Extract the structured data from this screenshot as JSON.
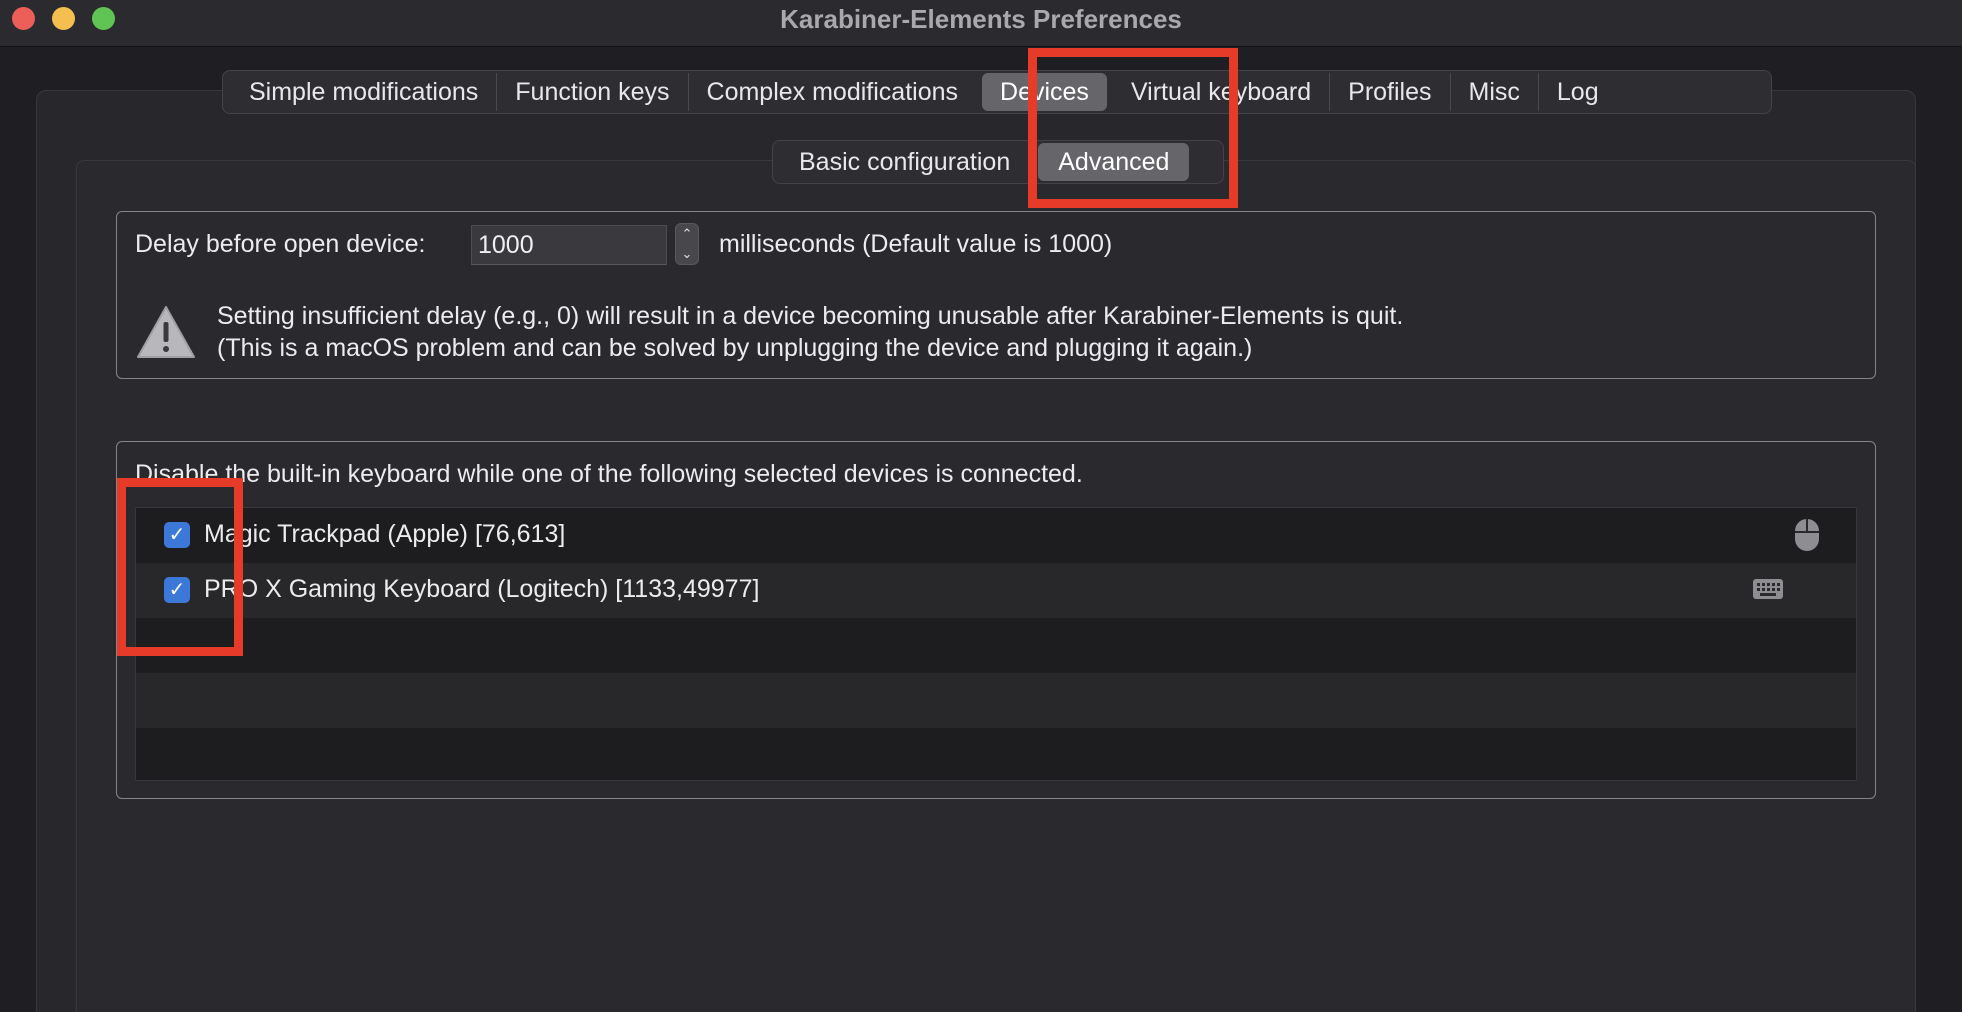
{
  "window": {
    "title": "Karabiner-Elements Preferences"
  },
  "tabs": [
    {
      "label": "Simple modifications",
      "active": false
    },
    {
      "label": "Function keys",
      "active": false
    },
    {
      "label": "Complex modifications",
      "active": false
    },
    {
      "label": "Devices",
      "active": true
    },
    {
      "label": "Virtual keyboard",
      "active": false
    },
    {
      "label": "Profiles",
      "active": false
    },
    {
      "label": "Misc",
      "active": false
    },
    {
      "label": "Log",
      "active": false
    }
  ],
  "subtabs": [
    {
      "label": "Basic configuration",
      "active": false
    },
    {
      "label": "Advanced",
      "active": true
    }
  ],
  "delay": {
    "label": "Delay before open device:",
    "value": "1000",
    "suffix": "milliseconds (Default value is 1000)",
    "warning_line1": "Setting insufficient delay (e.g., 0) will result in a device becoming unusable after Karabiner-Elements is quit.",
    "warning_line2": "(This is a macOS problem and can be solved by unplugging the device and plugging it again.)",
    "warning_icon": "warning-triangle-icon"
  },
  "disable_builtin": {
    "label": "Disable the built-in keyboard while one of the following selected devices is connected.",
    "devices": [
      {
        "name": "Magic Trackpad (Apple) [76,613]",
        "checked": true,
        "icon": "mouse-icon"
      },
      {
        "name": "PRO X Gaming Keyboard (Logitech) [1133,49977]",
        "checked": true,
        "icon": "keyboard-icon"
      }
    ]
  },
  "colors": {
    "annotation": "#e53b28",
    "checkbox": "#3c78d8",
    "active_tab": "#65656a"
  }
}
